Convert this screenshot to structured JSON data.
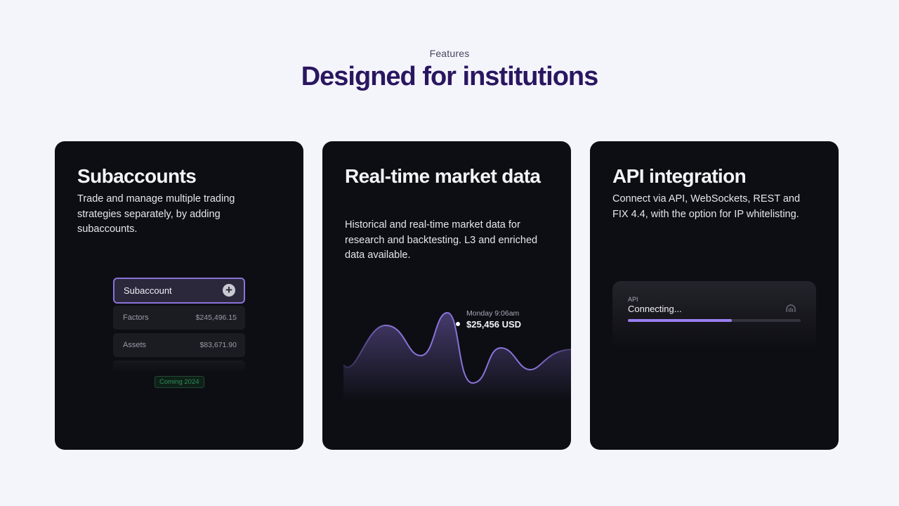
{
  "header": {
    "eyebrow": "Features",
    "title": "Designed for institutions"
  },
  "cards": [
    {
      "title": "Subaccounts",
      "description": "Trade and manage multiple trading strategies separately, by adding subaccounts.",
      "mock": {
        "header_label": "Subaccount",
        "rows": [
          {
            "label": "Factors",
            "value": "$245,496.15"
          },
          {
            "label": "Assets",
            "value": "$83,671.90"
          }
        ],
        "badge": "Coming 2024"
      }
    },
    {
      "title": "Real-time market data",
      "description": "Historical and real-time market data for research and backtesting. L3 and enriched data available.",
      "tooltip": {
        "date": "Monday 9:06am",
        "value": "$25,456 USD"
      }
    },
    {
      "title": "API integration",
      "description": "Connect via API, WebSockets, REST and FIX 4.4, with the option for IP whitelisting.",
      "panel": {
        "label": "API",
        "status": "Connecting...",
        "progress": 0.6,
        "icon": "dome-icon"
      }
    }
  ],
  "colors": {
    "page_bg": "#f4f4fb",
    "headline": "#2a1660",
    "card_bg": "#0d0e13",
    "accent": "#9b7ef0",
    "badge_green": "#2f8f58"
  }
}
